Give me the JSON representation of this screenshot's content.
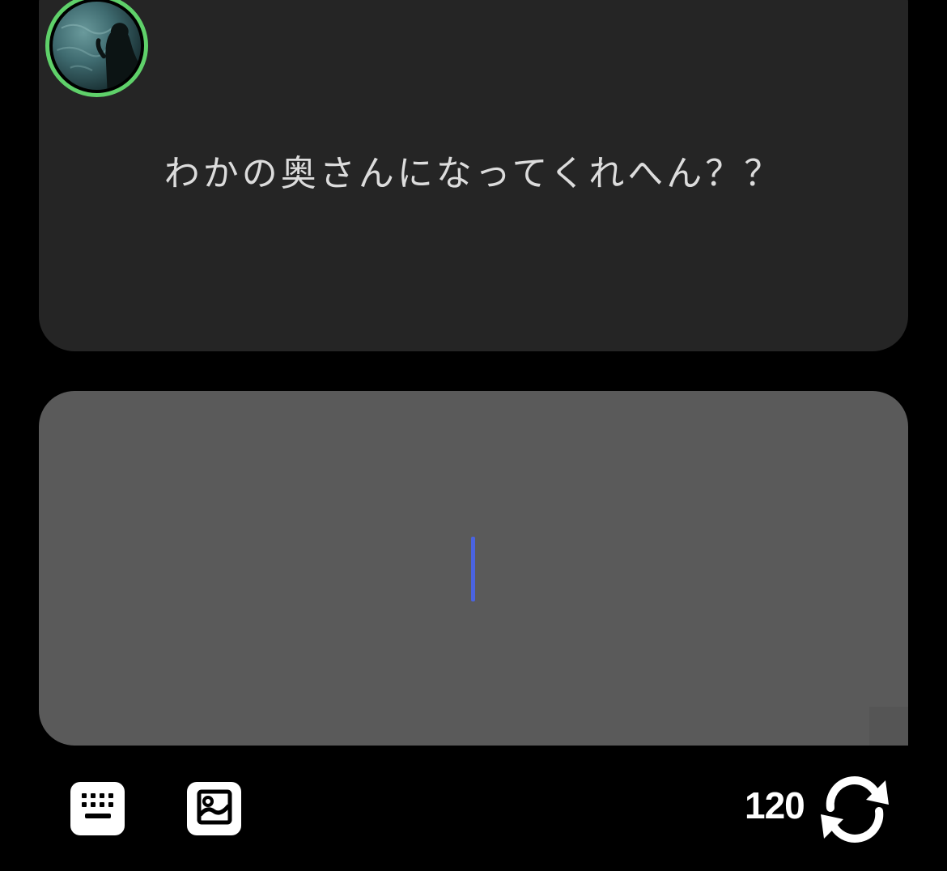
{
  "question": {
    "text": "わかの奥さんになってくれへん？？"
  },
  "answer": {
    "value": "",
    "placeholder": ""
  },
  "toolbar": {
    "keyboard_icon": "keyboard-icon",
    "image_icon": "image-icon",
    "count": "120",
    "refresh_icon": "refresh-icon"
  },
  "colors": {
    "avatar_ring": "#5fd16a",
    "caret": "#4a63e0",
    "question_card": "#252525",
    "answer_card": "#5a5a5a"
  }
}
